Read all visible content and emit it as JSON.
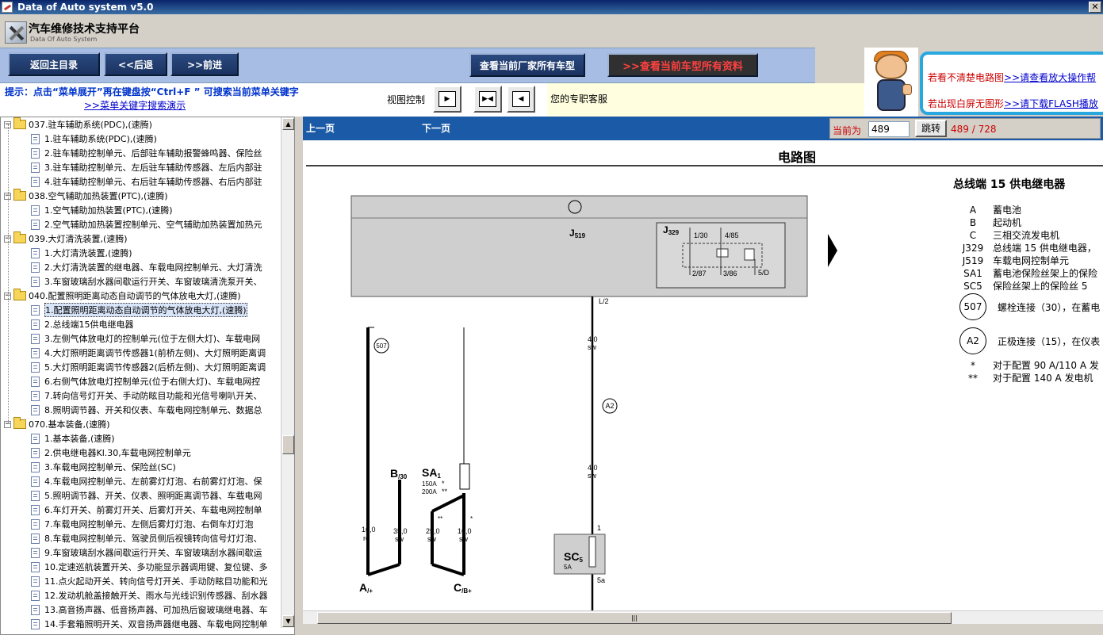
{
  "window": {
    "title": "Data of Auto system v5.0",
    "close": "✕"
  },
  "header": {
    "title": "汽车维修技术支持平台",
    "subtitle": "Data Of Auto System"
  },
  "toolbar": {
    "home": "返回主目录",
    "back": "<<后退",
    "forward": ">>前进",
    "all_models": "查看当前厂家所有车型",
    "all_data": ">>查看当前车型所有资料"
  },
  "hint": {
    "text": "提示：点击“菜单展开”再在键盘按“Ctrl+F ” 可搜索当前菜单关键字",
    "link": ">>菜单关键字搜索演示",
    "view_control": "视图控制",
    "service": "您的专职客服"
  },
  "notice": {
    "line1_text": "若看不清楚电路图",
    "line1_link": ">>请查看放大操作帮",
    "line2_text": "若出现白屏无图形",
    "line2_link": ">>请下载FLASH播放"
  },
  "tree": [
    {
      "level": 0,
      "label": "037.驻车辅助系统(PDC),(速腾)"
    },
    {
      "level": 1,
      "label": "1.驻车辅助系统(PDC),(速腾)"
    },
    {
      "level": 1,
      "label": "2.驻车辅助控制单元、后部驻车辅助报警蜂鸣器、保险丝"
    },
    {
      "level": 1,
      "label": "3.驻车辅助控制单元、左后驻车辅助传感器、左后内部驻"
    },
    {
      "level": 1,
      "label": "4.驻车辅助控制单元、右后驻车辅助传感器、右后内部驻"
    },
    {
      "level": 0,
      "label": "038.空气辅助加热装置(PTC),(速腾)"
    },
    {
      "level": 1,
      "label": "1.空气辅助加热装置(PTC),(速腾)"
    },
    {
      "level": 1,
      "label": "2.空气辅助加热装置控制单元、空气辅助加热装置加热元"
    },
    {
      "level": 0,
      "label": "039.大灯清洗装置,(速腾)"
    },
    {
      "level": 1,
      "label": "1.大灯清洗装置,(速腾)"
    },
    {
      "level": 1,
      "label": "2.大灯清洗装置的继电器、车载电网控制单元、大灯清洗"
    },
    {
      "level": 1,
      "label": "3.车窗玻璃刮水器间歇运行开关、车窗玻璃清洗泵开关、"
    },
    {
      "level": 0,
      "label": "040.配置照明距离动态自动调节的气体放电大灯,(速腾)"
    },
    {
      "level": 1,
      "label": "1.配置照明距离动态自动调节的气体放电大灯,(速腾)",
      "selected": true
    },
    {
      "level": 1,
      "label": "2.总线端15供电继电器"
    },
    {
      "level": 1,
      "label": "3.左侧气体放电灯的控制单元(位于左侧大灯)、车载电网"
    },
    {
      "level": 1,
      "label": "4.大灯照明距离调节传感器1(前桥左侧)、大灯照明距离调"
    },
    {
      "level": 1,
      "label": "5.大灯照明距离调节传感器2(后桥左侧)、大灯照明距离调"
    },
    {
      "level": 1,
      "label": "6.右侧气体放电灯控制单元(位于右侧大灯)、车载电网控"
    },
    {
      "level": 1,
      "label": "7.转向信号灯开关、手动防眩目功能和光信号喇叭开关、"
    },
    {
      "level": 1,
      "label": "8.照明调节器、开关和仪表、车载电网控制单元、数据总"
    },
    {
      "level": 0,
      "label": "070.基本装备,(速腾)"
    },
    {
      "level": 1,
      "label": "1.基本装备,(速腾)"
    },
    {
      "level": 1,
      "label": "2.供电继电器Kl.30,车载电网控制单元"
    },
    {
      "level": 1,
      "label": "3.车载电网控制单元、保险丝(SC)"
    },
    {
      "level": 1,
      "label": "4.车载电网控制单元、左前雾灯灯泡、右前雾灯灯泡、保"
    },
    {
      "level": 1,
      "label": "5.照明调节器、开关、仪表、照明距离调节器、车载电网"
    },
    {
      "level": 1,
      "label": "6.车灯开关、前雾灯开关、后雾灯开关、车载电网控制单"
    },
    {
      "level": 1,
      "label": "7.车载电网控制单元、左侧后雾灯灯泡、右倒车灯灯泡"
    },
    {
      "level": 1,
      "label": "8.车载电网控制单元、驾驶员侧后视镜转向信号灯灯泡、"
    },
    {
      "level": 1,
      "label": "9.车窗玻璃刮水器间歇运行开关、车窗玻璃刮水器间歇运"
    },
    {
      "level": 1,
      "label": "10.定速巡航装置开关、多功能显示器调用键、复位键、多"
    },
    {
      "level": 1,
      "label": "11.点火起动开关、转向信号灯开关、手动防眩目功能和光"
    },
    {
      "level": 1,
      "label": "12.发动机舱盖接触开关、雨水与光线识别传感器、刮水器"
    },
    {
      "level": 1,
      "label": "13.高音扬声器、低音扬声器、可加热后窗玻璃继电器、车"
    },
    {
      "level": 1,
      "label": "14.手套箱照明开关、双音扬声器继电器、车载电网控制单"
    }
  ],
  "nav": {
    "prev": "上一页",
    "next": "下一页",
    "current_label": "当前为",
    "current_value": "489",
    "jump": "跳转",
    "count": "489 / 728"
  },
  "diagram": {
    "title": "电路图",
    "legend_title": "总线端 15 供电继电器",
    "legend": [
      {
        "k": "A",
        "v": "蓄电池"
      },
      {
        "k": "B",
        "v": "起动机"
      },
      {
        "k": "C",
        "v": "三相交流发电机"
      },
      {
        "k": "J329",
        "v": "总线端 15 供电继电器，"
      },
      {
        "k": "J519",
        "v": "车载电网控制单元"
      },
      {
        "k": "SA1",
        "v": "蓄电池保险丝架上的保险"
      },
      {
        "k": "SC5",
        "v": "保险丝架上的保险丝 5"
      }
    ],
    "c507": "507",
    "c507_text": "螺栓连接（30），在蓄电",
    "ca2": "A2",
    "ca2_text": "正极连接（15），在仪表",
    "star1": "*",
    "star1_text": "对于配置 90 A/110 A 发",
    "star2": "**",
    "star2_text": "对于配置 140 A 发电机",
    "labels": {
      "j519": "J",
      "j519_sub": "519",
      "j329": "J",
      "j329_sub": "329",
      "p130": "1/30",
      "p485": "4/85",
      "p287": "2/87",
      "p386": "3/86",
      "p5d": "5/D",
      "l2": "L/2",
      "w1a": "4,0",
      "w1b": "sw",
      "w2a": "4,0",
      "w2b": "sw",
      "b30": "B",
      "b30_sub": "/30",
      "sa1": "SA",
      "sa1_sub": "1",
      "sa_150": "150A",
      "sa_200": "200A",
      "w16a": "16,0",
      "w16b": "ro",
      "w35a": "35,0",
      "w35b": "sw",
      "w25a": "25,0",
      "w25b": "sw",
      "w16c": "16,0",
      "w16d": "sw",
      "a_term": "A",
      "a_sub": "/+",
      "c_term": "C",
      "c_sub": "/B+",
      "sc5": "SC",
      "sc5_sub": "5",
      "sc5_amp": "5A",
      "pin1": "1",
      "pin5a": "5a",
      "star_a": "*",
      "star_aa": "**",
      "star_b": "**",
      "star_c": "*",
      "c507_small": "507",
      "a2_small": "A2"
    }
  },
  "colors": {
    "title_from": "#0a246a",
    "nav": "#1a5aa6",
    "toolbar": "#a8bde3",
    "red": "#cc0000",
    "notice_border": "#29a8e0"
  }
}
